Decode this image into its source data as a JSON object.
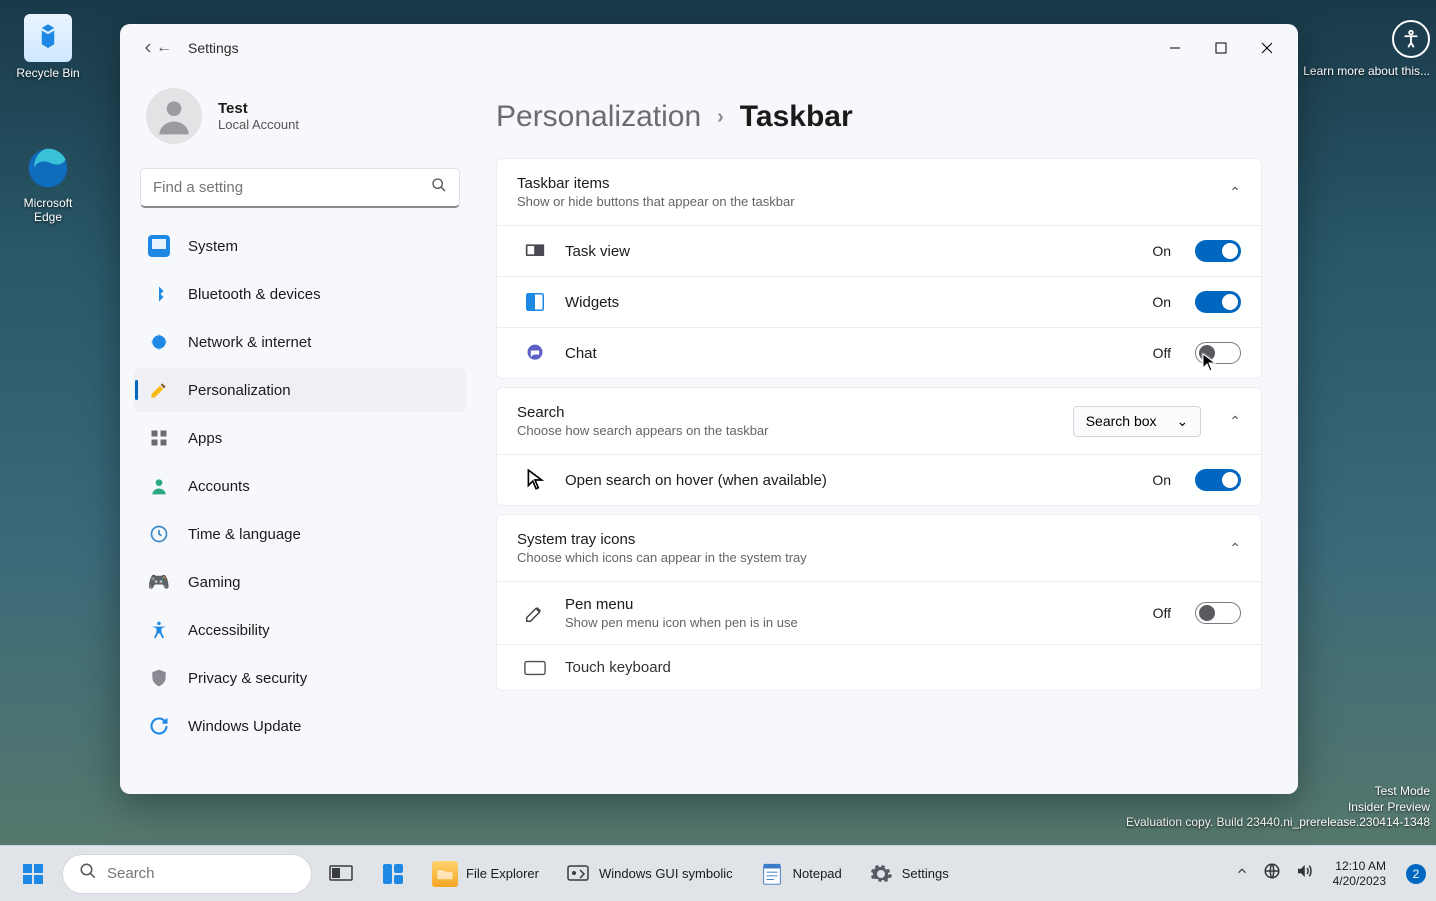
{
  "desktop": {
    "recycle_bin": "Recycle Bin",
    "edge": "Microsoft Edge"
  },
  "window": {
    "app_title": "Settings",
    "user_name": "Test",
    "user_sub": "Local Account",
    "search_placeholder": "Find a setting",
    "nav": {
      "system": "System",
      "bluetooth": "Bluetooth & devices",
      "network": "Network & internet",
      "personalization": "Personalization",
      "apps": "Apps",
      "accounts": "Accounts",
      "time": "Time & language",
      "gaming": "Gaming",
      "accessibility": "Accessibility",
      "privacy": "Privacy & security",
      "update": "Windows Update"
    },
    "breadcrumb_parent": "Personalization",
    "breadcrumb_current": "Taskbar",
    "taskbar_items": {
      "header": "Taskbar items",
      "sub": "Show or hide buttons that appear on the taskbar",
      "task_view": "Task view",
      "task_view_state": "On",
      "widgets": "Widgets",
      "widgets_state": "On",
      "chat": "Chat",
      "chat_state": "Off"
    },
    "search_section": {
      "header": "Search",
      "sub": "Choose how search appears on the taskbar",
      "dropdown_value": "Search box",
      "hover": "Open search on hover (when available)",
      "hover_state": "On"
    },
    "systray": {
      "header": "System tray icons",
      "sub": "Choose which icons can appear in the system tray",
      "pen_title": "Pen menu",
      "pen_sub": "Show pen menu icon when pen is in use",
      "pen_state": "Off",
      "touch": "Touch keyboard"
    }
  },
  "overlay": {
    "learn": "Learn more about this...",
    "mode": "Test Mode",
    "preview": "Insider Preview",
    "eval": "Evaluation copy. Build 23440.ni_prerelease.230414-1348"
  },
  "taskbar": {
    "search_placeholder": "Search",
    "file_explorer": "File Explorer",
    "gui_symbolic": "Windows GUI symbolic",
    "notepad": "Notepad",
    "settings": "Settings",
    "time": "12:10 AM",
    "date": "4/20/2023",
    "notif_count": "2"
  }
}
